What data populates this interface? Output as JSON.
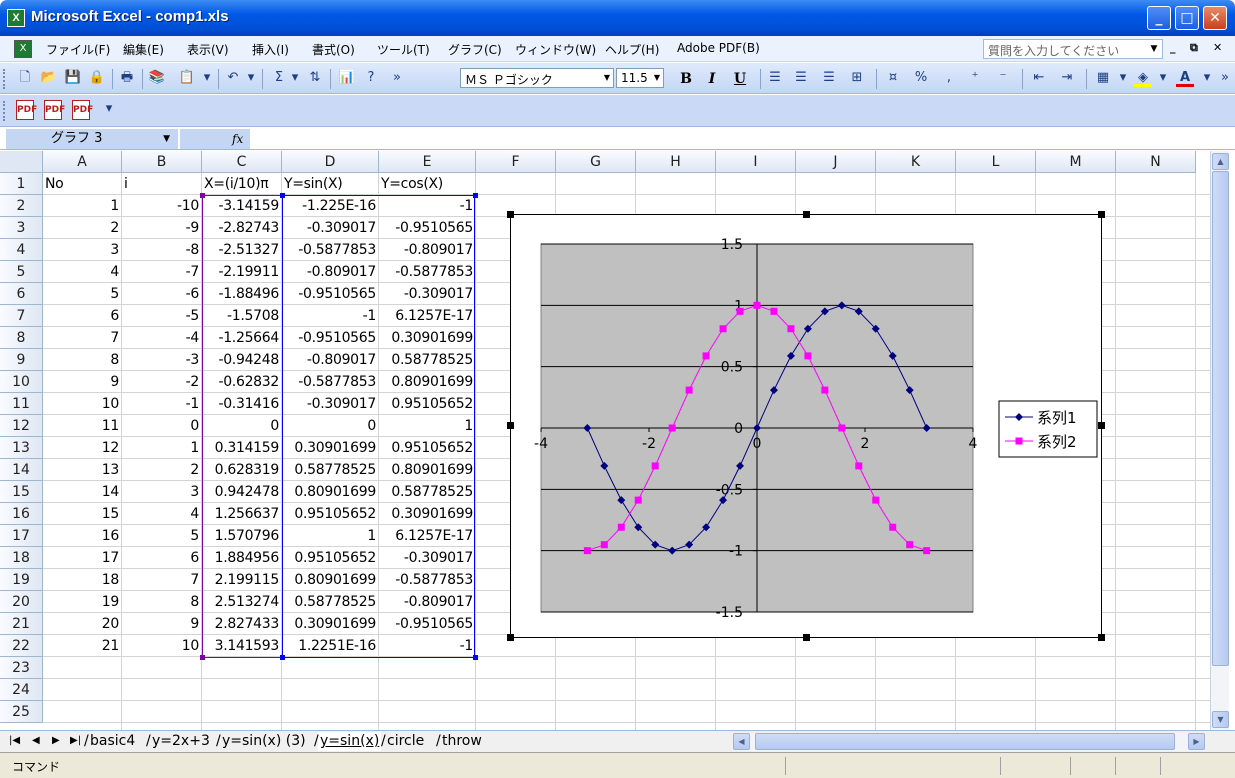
{
  "window": {
    "title": "Microsoft Excel - comp1.xls",
    "app_icon": "X"
  },
  "menu": {
    "items": [
      "ファイル(F)",
      "編集(E)",
      "表示(V)",
      "挿入(I)",
      "書式(O)",
      "ツール(T)",
      "グラフ(C)",
      "ウィンドウ(W)",
      "ヘルプ(H)",
      "Adobe PDF(B)"
    ],
    "help_placeholder": "質問を入力してください"
  },
  "toolbar": {
    "font_name": "ＭＳ Ｐゴシック",
    "font_size": "11.5",
    "bold": "B",
    "italic": "I",
    "underline": "U",
    "percent": "%"
  },
  "formula_bar": {
    "name_box": "グラフ 3",
    "fx": "fx",
    "content": ""
  },
  "columns": [
    "A",
    "B",
    "C",
    "D",
    "E",
    "F",
    "G",
    "H",
    "I",
    "J",
    "K",
    "L",
    "M",
    "N"
  ],
  "rows": [
    "1",
    "2",
    "3",
    "4",
    "5",
    "6",
    "7",
    "8",
    "9",
    "10",
    "11",
    "12",
    "13",
    "14",
    "15",
    "16",
    "17",
    "18",
    "19",
    "20",
    "21",
    "22",
    "23",
    "24",
    "25"
  ],
  "table": {
    "header": [
      "No",
      "i",
      "X=(i/10)π",
      "Y=sin(X)",
      "Y=cos(X)"
    ],
    "data": [
      [
        "1",
        "-10",
        "-3.14159",
        "-1.225E-16",
        "-1"
      ],
      [
        "2",
        "-9",
        "-2.82743",
        "-0.309017",
        "-0.9510565"
      ],
      [
        "3",
        "-8",
        "-2.51327",
        "-0.5877853",
        "-0.809017"
      ],
      [
        "4",
        "-7",
        "-2.19911",
        "-0.809017",
        "-0.5877853"
      ],
      [
        "5",
        "-6",
        "-1.88496",
        "-0.9510565",
        "-0.309017"
      ],
      [
        "6",
        "-5",
        "-1.5708",
        "-1",
        "6.1257E-17"
      ],
      [
        "7",
        "-4",
        "-1.25664",
        "-0.9510565",
        "0.30901699"
      ],
      [
        "8",
        "-3",
        "-0.94248",
        "-0.809017",
        "0.58778525"
      ],
      [
        "9",
        "-2",
        "-0.62832",
        "-0.5877853",
        "0.80901699"
      ],
      [
        "10",
        "-1",
        "-0.31416",
        "-0.309017",
        "0.95105652"
      ],
      [
        "11",
        "0",
        "0",
        "0",
        "1"
      ],
      [
        "12",
        "1",
        "0.314159",
        "0.30901699",
        "0.95105652"
      ],
      [
        "13",
        "2",
        "0.628319",
        "0.58778525",
        "0.80901699"
      ],
      [
        "14",
        "3",
        "0.942478",
        "0.80901699",
        "0.58778525"
      ],
      [
        "15",
        "4",
        "1.256637",
        "0.95105652",
        "0.30901699"
      ],
      [
        "16",
        "5",
        "1.570796",
        "1",
        "6.1257E-17"
      ],
      [
        "17",
        "6",
        "1.884956",
        "0.95105652",
        "-0.309017"
      ],
      [
        "18",
        "7",
        "2.199115",
        "0.80901699",
        "-0.5877853"
      ],
      [
        "19",
        "8",
        "2.513274",
        "0.58778525",
        "-0.809017"
      ],
      [
        "20",
        "9",
        "2.827433",
        "0.30901699",
        "-0.9510565"
      ],
      [
        "21",
        "10",
        "3.141593",
        "1.2251E-16",
        "-1"
      ]
    ]
  },
  "chart_data": {
    "type": "scatter",
    "title": "",
    "xlabel": "",
    "ylabel": "",
    "xlim": [
      -4,
      4
    ],
    "ylim": [
      -1.5,
      1.5
    ],
    "xticks": [
      "-4",
      "-2",
      "0",
      "2",
      "4"
    ],
    "yticks": [
      "1.5",
      "1",
      "0.5",
      "0",
      "-0.5",
      "-1",
      "-1.5"
    ],
    "grid": true,
    "legend_position": "right",
    "x": [
      -3.14159,
      -2.82743,
      -2.51327,
      -2.19911,
      -1.88496,
      -1.5708,
      -1.25664,
      -0.94248,
      -0.62832,
      -0.31416,
      0,
      0.314159,
      0.628319,
      0.942478,
      1.256637,
      1.570796,
      1.884956,
      2.199115,
      2.513274,
      2.827433,
      3.141593
    ],
    "series": [
      {
        "name": "系列1",
        "color": "#000080",
        "marker": "diamond",
        "values": [
          0,
          -0.309017,
          -0.5877853,
          -0.809017,
          -0.9510565,
          -1,
          -0.9510565,
          -0.809017,
          -0.5877853,
          -0.309017,
          0,
          0.30901699,
          0.58778525,
          0.80901699,
          0.95105652,
          1,
          0.95105652,
          0.80901699,
          0.58778525,
          0.30901699,
          0
        ]
      },
      {
        "name": "系列2",
        "color": "#ff00ff",
        "marker": "square",
        "values": [
          -1,
          -0.9510565,
          -0.809017,
          -0.5877853,
          -0.309017,
          0,
          0.30901699,
          0.58778525,
          0.80901699,
          0.95105652,
          1,
          0.95105652,
          0.80901699,
          0.58778525,
          0.30901699,
          0,
          -0.309017,
          -0.5877853,
          -0.809017,
          -0.9510565,
          -1
        ]
      }
    ]
  },
  "sheet_tabs": [
    "basic4",
    "y=2x+3",
    "y=sin(x) (3)",
    "y=sin(x)",
    "circle",
    "throw"
  ],
  "active_tab": "y=sin(x)",
  "status": {
    "mode": "コマンド"
  }
}
